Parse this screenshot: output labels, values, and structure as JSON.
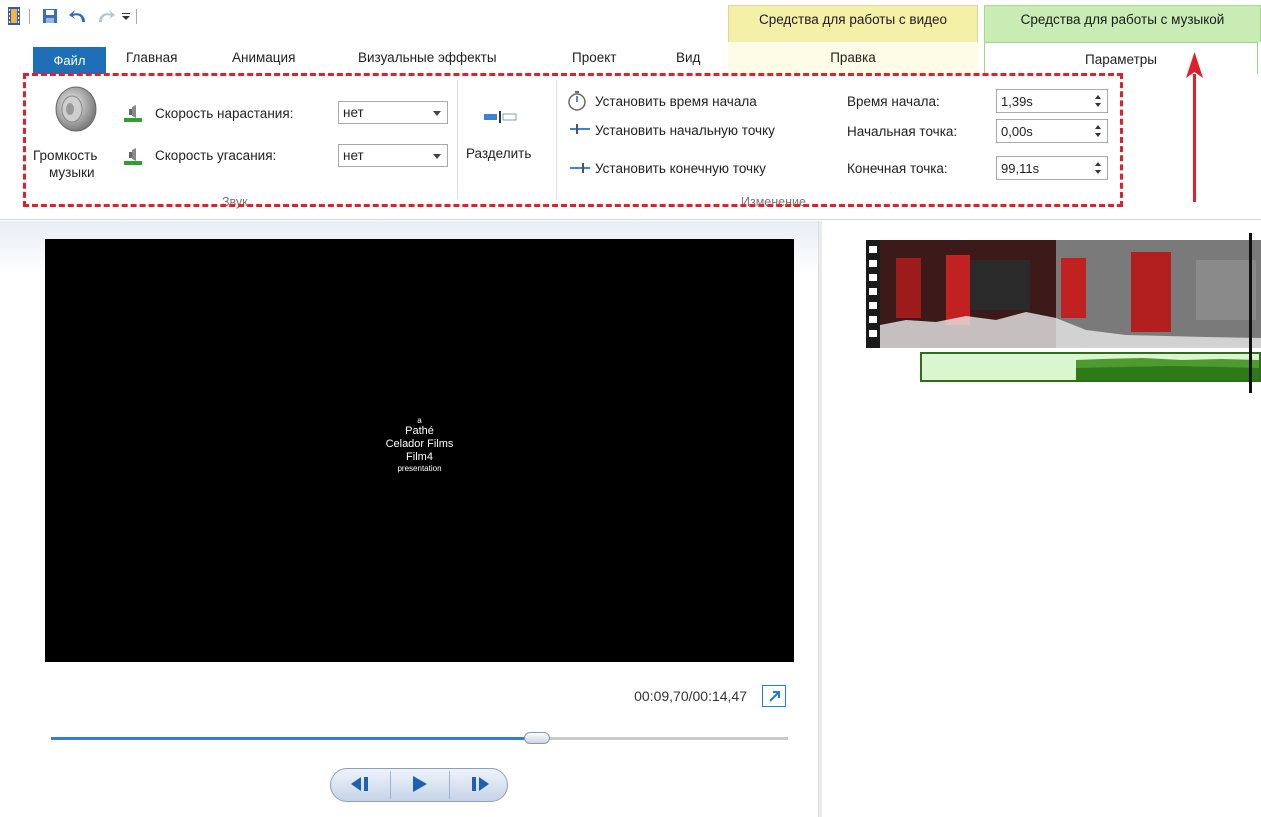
{
  "qat": {
    "icons": [
      "app-film-icon",
      "save-icon",
      "undo-icon",
      "redo-icon",
      "customize-qat-icon"
    ]
  },
  "context_tabs": {
    "video_tools": "Средства для работы с видео",
    "music_tools": "Средства для работы с музыкой"
  },
  "tabs": {
    "file": "Файл",
    "home": "Главная",
    "animation": "Анимация",
    "visual_effects": "Визуальные эффекты",
    "project": "Проект",
    "view": "Вид",
    "edit": "Правка",
    "options": "Параметры"
  },
  "ribbon": {
    "audio": {
      "volume_label_line1": "Громкость",
      "volume_label_line2": "музыки",
      "fade_in_label": "Скорость нарастания:",
      "fade_in_value": "нет",
      "fade_out_label": "Скорость угасания:",
      "fade_out_value": "нет",
      "group_label": "Звук"
    },
    "split_label": "Разделить",
    "editing": {
      "set_start_time": "Установить время начала",
      "set_start_point": "Установить начальную точку",
      "set_end_point": "Установить конечную точку",
      "start_time_label": "Время начала:",
      "start_time_value": "1,39s",
      "start_point_label": "Начальная точка:",
      "start_point_value": "0,00s",
      "end_point_label": "Конечная точка:",
      "end_point_value": "99,11s",
      "group_label": "Изменение"
    }
  },
  "player": {
    "video_text": {
      "line1": "a",
      "line2": "Pathé",
      "line3": "Celador Films",
      "line4": "Film4",
      "line5": "presentation"
    },
    "timecode": "00:09,70/00:14,47",
    "seek_progress": 0.66
  },
  "colors": {
    "file_tab": "#1e6fb8",
    "video_context": "#f5f0a8",
    "music_context": "#c8ecb4",
    "highlight": "#e0202a",
    "seek": "#2f7ed8"
  }
}
